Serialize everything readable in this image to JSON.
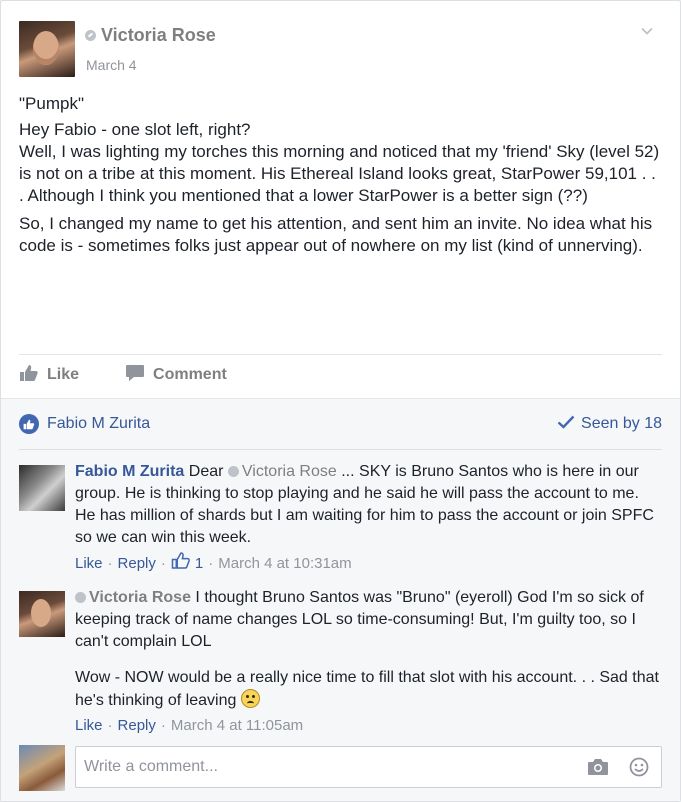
{
  "post": {
    "author": "Victoria Rose",
    "date": "March 4",
    "paragraphs": [
      "\"Pumpk\"",
      "Hey Fabio - one slot left, right?",
      "Well, I was lighting my torches this morning and noticed that my 'friend' Sky (level 52) is not on a tribe at this moment. His Ethereal Island looks great, StarPower 59,101 . . . Although I think you mentioned that a lower StarPower is a better sign (??)",
      "So, I changed my name to get his attention, and sent him an invite. No idea what his code is - sometimes folks just appear out of nowhere on my list (kind of unnerving)."
    ],
    "actions": {
      "like": "Like",
      "comment": "Comment"
    }
  },
  "reactions": {
    "liked_by": "Fabio M Zurita",
    "seen": "Seen by 18"
  },
  "comments": [
    {
      "author": "Fabio M Zurita",
      "prefix": "Dear",
      "mention": "Victoria Rose",
      "text": "... SKY is Bruno Santos who is here in our group. He is thinking to stop playing and he said he will pass the account to me. He has million of shards but I am waiting for him to pass the account or join SPFC so we can win this week.",
      "like": "Like",
      "reply": "Reply",
      "like_count": "1",
      "time": "March 4 at 10:31am"
    },
    {
      "author": "Victoria Rose",
      "text": "I thought Bruno Santos was \"Bruno\" (eyeroll) God I'm so sick of keeping track of name changes LOL so time-consuming! But, I'm guilty too, so I can't complain LOL",
      "text2": "Wow - NOW would be a really nice time to fill that slot with his account. . . Sad that he's thinking of leaving",
      "like": "Like",
      "reply": "Reply",
      "time": "March 4 at 11:05am"
    }
  ],
  "composer": {
    "placeholder": "Write a comment..."
  },
  "icons": {
    "status": "status-icon",
    "chevron": "chevron-down-icon",
    "like": "thumbs-up-icon",
    "comment": "comment-bubble-icon",
    "check": "checkmark-icon",
    "camera": "camera-icon",
    "emoji": "smiley-icon"
  },
  "colors": {
    "link": "#365899",
    "like_badge": "#4267b2",
    "muted": "#90949c"
  }
}
